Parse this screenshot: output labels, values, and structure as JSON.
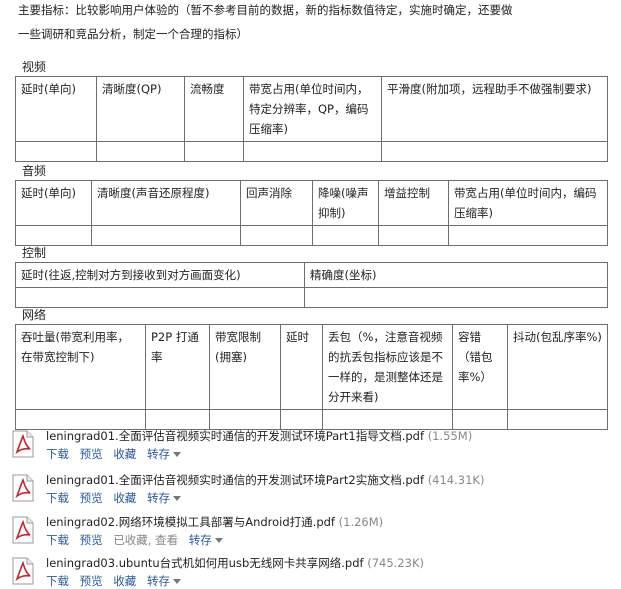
{
  "intro": {
    "line1": "主要指标：比较影响用户体验的（暂不参考目前的数据，新的指标数值待定，实施时确定，还要做",
    "line2": "一些调研和竞品分析，制定一个合理的指标）"
  },
  "sections": {
    "video": {
      "title": "视频",
      "headers": [
        "延时(单向)",
        "清晰度(QP)",
        "流畅度",
        "带宽占用(单位时间内，特定分辨率，QP，编码压缩率)",
        "平滑度(附加项，远程助手不做强制要求)"
      ]
    },
    "audio": {
      "title": "音频",
      "headers": [
        "延时(单向)",
        "清晰度(声音还原程度)",
        "回声消除",
        "降噪(噪声抑制)",
        "增益控制",
        "带宽占用(单位时间内，编码压缩率)"
      ]
    },
    "control": {
      "title": "控制",
      "headers": [
        "延时(往返,控制对方到接收到对方画面变化)",
        "精确度(坐标)"
      ]
    },
    "network": {
      "title": "网络",
      "headers": [
        "吞吐量(带宽利用率，在带宽控制下)",
        "P2P 打通率",
        "带宽限制(拥塞)",
        "延时",
        "丢包（%，注意音视频的抗丢包指标应该是不一样的，是测整体还是分开来看)",
        "容错（错包率%）",
        "抖动(包乱序率%)"
      ]
    }
  },
  "attachments": [
    {
      "name": "leningrad01.全面评估音视频实时通信的开发测试环境Part1指导文档.pdf",
      "size": "(1.55M)",
      "actions": [
        "下载",
        "预览",
        "收藏"
      ],
      "forward": "转存"
    },
    {
      "name": "leningrad01.全面评估音视频实时通信的开发测试环境Part2实施文档.pdf",
      "size": "(414.31K)",
      "actions": [
        "下载",
        "预览",
        "收藏"
      ],
      "forward": "转存"
    },
    {
      "name": "leningrad02.网络环境模拟工具部署与Android打通.pdf",
      "size": "(1.26M)",
      "actions": [
        "下载",
        "预览",
        "已收藏, 查看"
      ],
      "forward": "转存"
    },
    {
      "name": "leningrad03.ubuntu台式机如何用usb无线网卡共享网络.pdf",
      "size": "(745.23K)",
      "actions": [
        "下载",
        "预览",
        "收藏"
      ],
      "forward": "转存"
    }
  ],
  "colors": {
    "link": "#2a5b9e",
    "muted": "#888888",
    "pdf_red": "#c8262c"
  }
}
